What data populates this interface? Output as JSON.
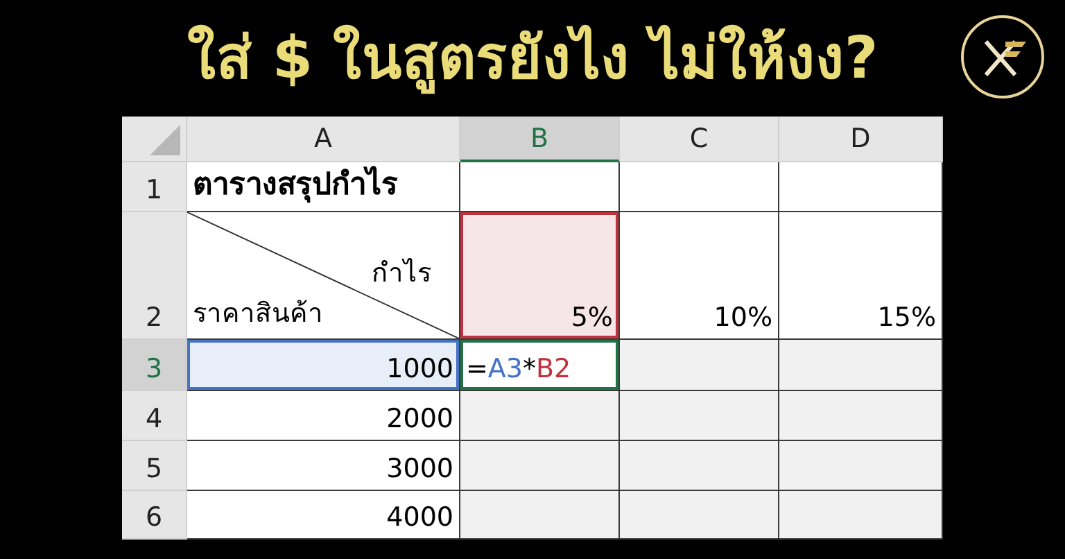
{
  "title": "ใส่ $ ในสูตรยังไง ไม่ให้งง?",
  "sheet": {
    "columns": [
      {
        "label": "A",
        "selected": false
      },
      {
        "label": "B",
        "selected": true
      },
      {
        "label": "C",
        "selected": false
      },
      {
        "label": "D",
        "selected": false
      }
    ],
    "rows": [
      {
        "header": "1",
        "selected": false,
        "cells": [
          {
            "kind": "title",
            "text": "ตารางสรุปกำไร"
          },
          {
            "kind": "empty"
          },
          {
            "kind": "empty"
          },
          {
            "kind": "empty"
          }
        ]
      },
      {
        "header": "2",
        "selected": false,
        "cells": [
          {
            "kind": "diagonal",
            "top": "กำไร",
            "bottom": "ราคาสินค้า"
          },
          {
            "kind": "value",
            "text": "5%",
            "color": "#c0333d"
          },
          {
            "kind": "value",
            "text": "10%"
          },
          {
            "kind": "value",
            "text": "15%"
          }
        ]
      },
      {
        "header": "3",
        "selected": true,
        "cells": [
          {
            "kind": "value",
            "text": "1000",
            "color": "#4472c4"
          },
          {
            "kind": "formula",
            "color": "#217346",
            "parts": [
              {
                "text": "=",
                "color": "#000000"
              },
              {
                "text": "A3",
                "color": "#4472c4"
              },
              {
                "text": "*",
                "color": "#000000"
              },
              {
                "text": "B2",
                "color": "#c0333d"
              }
            ]
          },
          {
            "kind": "empty",
            "shaded": true
          },
          {
            "kind": "empty",
            "shaded": true
          }
        ]
      },
      {
        "header": "4",
        "selected": false,
        "cells": [
          {
            "kind": "value",
            "text": "2000"
          },
          {
            "kind": "empty",
            "shaded": true
          },
          {
            "kind": "empty",
            "shaded": true
          },
          {
            "kind": "empty",
            "shaded": true
          }
        ]
      },
      {
        "header": "5",
        "selected": false,
        "cells": [
          {
            "kind": "value",
            "text": "3000"
          },
          {
            "kind": "empty",
            "shaded": true
          },
          {
            "kind": "empty",
            "shaded": true
          },
          {
            "kind": "empty",
            "shaded": true
          }
        ]
      },
      {
        "header": "6",
        "selected": false,
        "cells": [
          {
            "kind": "value",
            "text": "4000"
          },
          {
            "kind": "empty",
            "shaded": true
          },
          {
            "kind": "empty",
            "shaded": true
          },
          {
            "kind": "empty",
            "shaded": true
          }
        ]
      }
    ]
  }
}
